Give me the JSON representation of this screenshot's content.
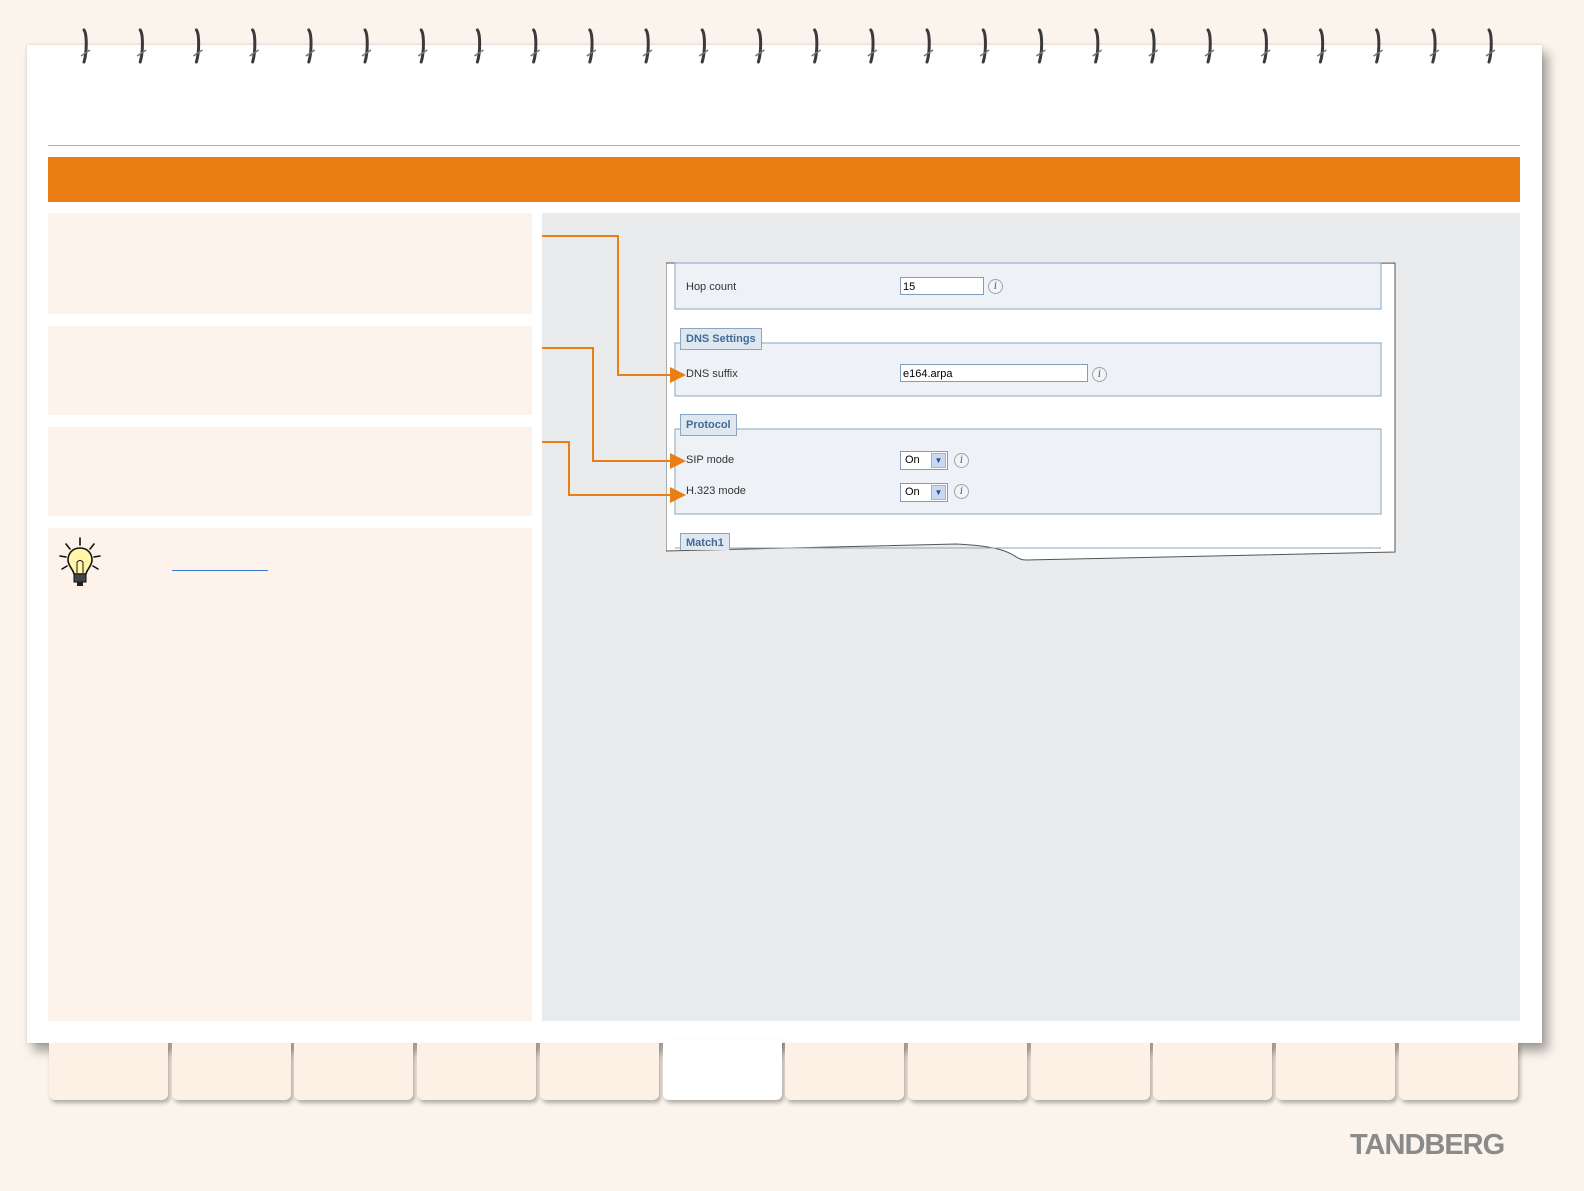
{
  "screenshot": {
    "hop_count": {
      "label": "Hop count",
      "value": "15"
    },
    "dns_settings": {
      "legend": "DNS Settings",
      "dns_suffix": {
        "label": "DNS suffix",
        "value": "e164.arpa"
      }
    },
    "protocol": {
      "legend": "Protocol",
      "sip_mode": {
        "label": "SIP mode",
        "value": "On"
      },
      "h323_mode": {
        "label": "H.323 mode",
        "value": "On"
      }
    },
    "match1": {
      "legend": "Match1"
    },
    "info_glyph": "i"
  },
  "icons": [
    "lightbulb-icon",
    "info-icon",
    "dropdown-arrow-icon",
    "ring-binder-icon"
  ],
  "colors": {
    "accent": "#ea7d14",
    "legend_text": "#3f6b96",
    "link": "#3b79c8"
  },
  "brand": {
    "logo_text": "TANDBERG"
  },
  "tabs": {
    "count": 12,
    "active_index": 5
  }
}
